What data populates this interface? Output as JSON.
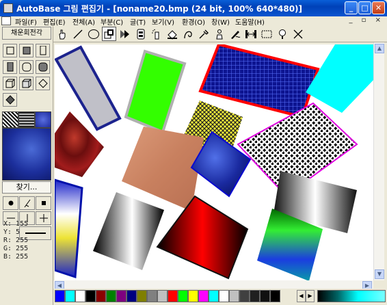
{
  "window": {
    "title": "AutoBase 그림 편집기 - [noname20.bmp (24 bit, 100% 640*480)]"
  },
  "menu": [
    {
      "label": "파일(F)"
    },
    {
      "label": "편집(E)"
    },
    {
      "label": "전체(A)"
    },
    {
      "label": "부분(C)"
    },
    {
      "label": "글(T)"
    },
    {
      "label": "보기(V)"
    },
    {
      "label": "환경(O)"
    },
    {
      "label": "창(W)"
    },
    {
      "label": "도움말(H)"
    }
  ],
  "toolbar": [
    "hand-select-icon",
    "line-icon",
    "ellipse-icon",
    "copy-region-icon",
    "arrow-shape-icon",
    "text-box-icon",
    "spray-icon",
    "fill-bucket-icon",
    "curve-icon",
    "eyedropper-icon",
    "stamp-icon",
    "wave-brush-icon",
    "resize-icon",
    "rectangle-select-icon",
    "magnify-icon",
    "cross-icon"
  ],
  "left": {
    "font_label": "채운회전각",
    "find_label": "찾기...",
    "swatches": [
      "#888888",
      "#555555",
      "#3f3fff"
    ],
    "info": {
      "x": "X:  155",
      "y": "Y:  5",
      "r": "R:  255",
      "g": "G:  255",
      "b": "B:  255"
    }
  },
  "palette": [
    "#0000ff",
    "#00ffff",
    "#ffffff",
    "#000000",
    "#8b0000",
    "#008000",
    "#7f007f",
    "#00007f",
    "#7f7f00",
    "#808080",
    "#c0c0c0",
    "#ff0000",
    "#00ff00",
    "#ffff00",
    "#ff00ff",
    "#00ffff",
    "#ffffff",
    "#c0c0c0",
    "#404040",
    "#202020",
    "#101010",
    "#000000"
  ]
}
